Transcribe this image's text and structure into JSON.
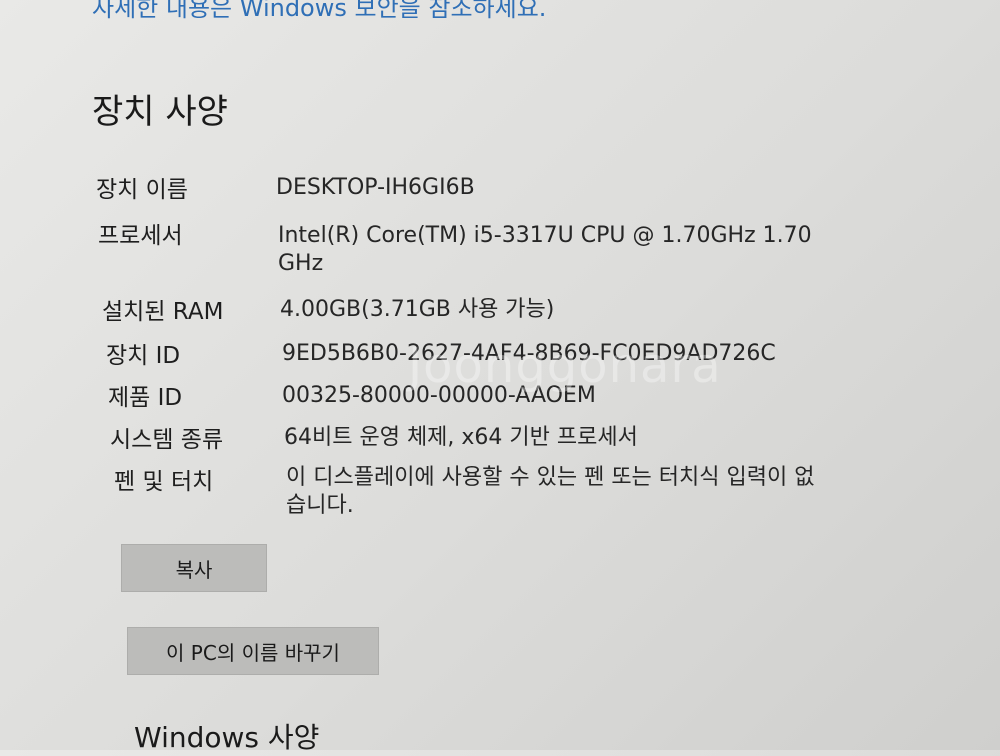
{
  "header": {
    "security_link": "자세한 내용은 Windows 보안을 참조하세요."
  },
  "device_specs": {
    "title": "장치 사양",
    "rows": [
      {
        "label": "장치 이름",
        "value": "DESKTOP-IH6GI6B"
      },
      {
        "label": "프로세서",
        "value": "Intel(R) Core(TM) i5-3317U CPU @ 1.70GHz   1.70 GHz"
      },
      {
        "label": "설치된 RAM",
        "value": "4.00GB(3.71GB 사용 가능)"
      },
      {
        "label": "장치 ID",
        "value": "9ED5B6B0-2627-4AF4-8B69-FC0ED9AD726C"
      },
      {
        "label": "제품 ID",
        "value": "00325-80000-00000-AAOEM"
      },
      {
        "label": "시스템 종류",
        "value": "64비트 운영 체제, x64 기반 프로세서"
      },
      {
        "label": "펜 및 터치",
        "value": "이 디스플레이에 사용할 수 있는 펜 또는 터치식 입력이 없습니다."
      }
    ],
    "copy_button": "복사",
    "rename_button": "이 PC의 이름 바꾸기"
  },
  "watermark": "Joonggonara",
  "windows_specs": {
    "title": "Windows 사양"
  }
}
